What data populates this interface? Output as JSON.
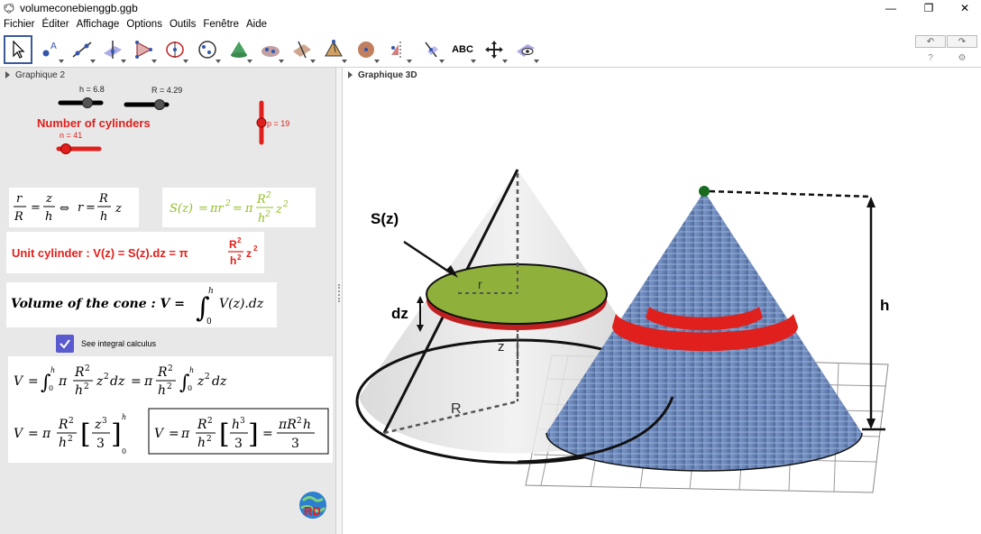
{
  "window": {
    "title": "volumeconebienggb.ggb",
    "minimize": "—",
    "restore": "❐",
    "close": "✕"
  },
  "menu": [
    "Fichier",
    "Éditer",
    "Affichage",
    "Options",
    "Outils",
    "Fenêtre",
    "Aide"
  ],
  "toolbar": {
    "text_tool_label": "ABC",
    "undo": "↶",
    "redo": "↷",
    "help": "?",
    "settings": "⚙"
  },
  "left_panel": {
    "header": "Graphique 2",
    "sliders": {
      "h": "h = 6.8",
      "R": "R = 4.29",
      "p": "p = 19",
      "n": "n = 41"
    },
    "heading": "Number of cylinders",
    "checkbox_label": "See integral calculus",
    "formulas": {
      "unit_cylinder": "Unit cylinder : V(z) = S(z).dz = π",
      "volume": "Volume of the cone : V =",
      "volume_end": "V(z).dz"
    }
  },
  "right_panel": {
    "header": "Graphique 3D",
    "labels": {
      "sz": "S(z)",
      "dz": "dz",
      "r": "r",
      "z": "z",
      "R": "R",
      "h": "h"
    }
  },
  "colors": {
    "accent_red": "#e0201c",
    "accent_green": "#8fbf20",
    "cone_blue": "#6a86b8",
    "disk_green": "#8fb03a"
  }
}
